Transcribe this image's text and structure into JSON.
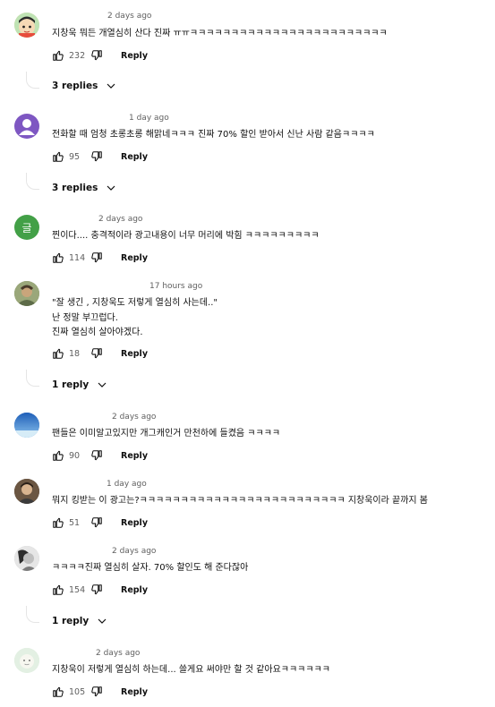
{
  "comments": [
    {
      "time": "2 days ago",
      "lines": [
        "지창욱 뭐든 개열심히 산다 진짜 ㅠㅠㅋㅋㅋㅋㅋㅋㅋㅋㅋㅋㅋㅋㅋㅋㅋㅋㅋㅋㅋㅋㅋㅋㅋㅋ"
      ],
      "likes": "232",
      "reply_label": "Reply",
      "replies_label": "3 replies",
      "avatar_icon": "anime-character-avatar",
      "avatar_color": "#f3d2a2"
    },
    {
      "time": "1 day ago",
      "lines": [
        "전화할 때 엄청 초롱초롱 해맑네ㅋㅋㅋ 진짜 70% 할인 받아서 신난 사람 같음ㅋㅋㅋㅋ"
      ],
      "likes": "95",
      "reply_label": "Reply",
      "replies_label": "3 replies",
      "avatar_icon": "default-user-icon",
      "avatar_color": "#7e57c2"
    },
    {
      "time": "2 days ago",
      "lines": [
        "찐이다.... 충격적이라 광고내용이 너무 머리에 박힘 ㅋㅋㅋㅋㅋㅋㅋㅋㅋ"
      ],
      "likes": "114",
      "reply_label": "Reply",
      "avatar_letter": "글",
      "avatar_icon": "letter-avatar",
      "avatar_color": "#43a047"
    },
    {
      "time": "17 hours ago",
      "lines": [
        "\"잘 생긴 , 지창욱도 저렇게 열심히 사는데..\"",
        "난 정말 부끄럽다.",
        "진짜 열심히 살아야겠다."
      ],
      "likes": "18",
      "reply_label": "Reply",
      "replies_label": "1 reply",
      "avatar_icon": "photo-avatar",
      "avatar_color": "#8a9a6b"
    },
    {
      "time": "2 days ago",
      "lines": [
        "팬들은 이미알고있지만 개그캐인거 만천하에  들켰음 ㅋㅋㅋㅋ"
      ],
      "likes": "90",
      "reply_label": "Reply",
      "avatar_icon": "sky-avatar",
      "avatar_color": "#3f7fd1"
    },
    {
      "time": "1 day ago",
      "lines": [
        "뭐지 킹받는 이 광고는?ㅋㅋㅋㅋㅋㅋㅋㅋㅋㅋㅋㅋㅋㅋㅋㅋㅋㅋㅋㅋㅋㅋㅋㅋㅋ 지창욱이라 끝까지 봄"
      ],
      "likes": "51",
      "reply_label": "Reply",
      "avatar_icon": "person-photo-avatar",
      "avatar_color": "#5a4a3a"
    },
    {
      "time": "2 days ago",
      "lines": [
        "ㅋㅋㅋㅋ진짜 열심히 살자. 70% 할인도 해 준다잖아"
      ],
      "likes": "154",
      "reply_label": "Reply",
      "replies_label": "1 reply",
      "avatar_icon": "bw-photo-avatar",
      "avatar_color": "#bdbdbd"
    },
    {
      "time": "2 days ago",
      "lines": [
        "지창욱이 저렇게 열심히 하는데... 쓸게요 써야만 할 것 같아요ㅋㅋㅋㅋㅋㅋ"
      ],
      "likes": "105",
      "reply_label": "Reply",
      "avatar_icon": "pastel-avatar",
      "avatar_color": "#d9ecd9"
    }
  ]
}
